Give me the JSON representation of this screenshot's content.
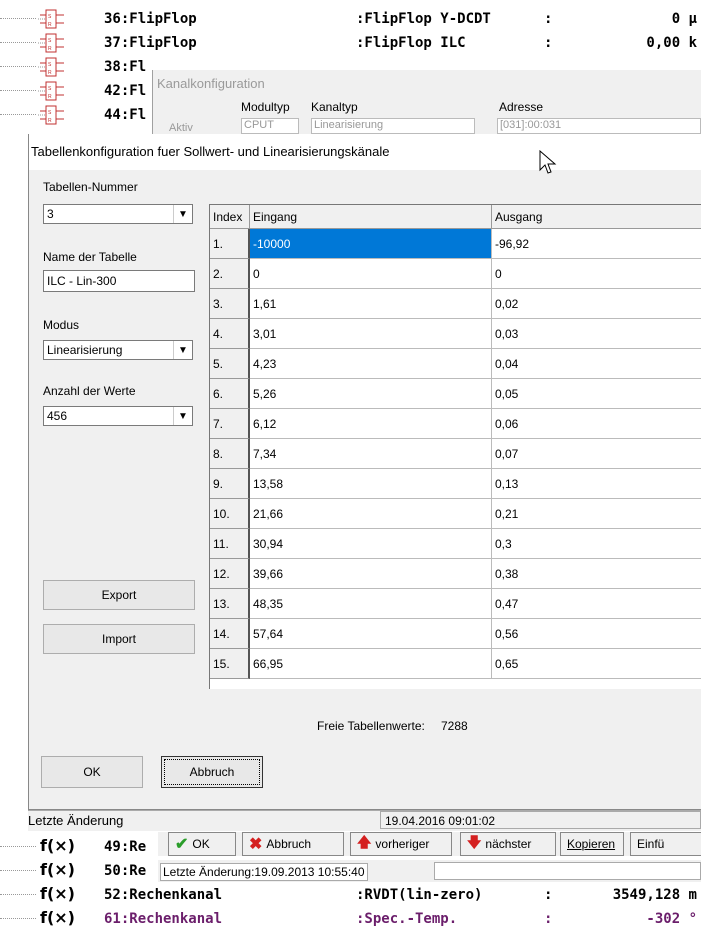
{
  "tree_rows": [
    {
      "id": "36",
      "name": "36:FlipFlop",
      "type": ":FlipFlop Y-DCDT",
      "colon": ":",
      "value": "0 µ",
      "icon": "flipflop"
    },
    {
      "id": "37",
      "name": "37:FlipFlop",
      "type": ":FlipFlop ILC",
      "colon": ":",
      "value": "0,00 k",
      "icon": "flipflop"
    },
    {
      "id": "38",
      "name": "38:Fl",
      "icon": "flipflop"
    },
    {
      "id": "42",
      "name": "42:Fl",
      "icon": "flipflop"
    },
    {
      "id": "44",
      "name": "44:Fl",
      "icon": "flipflop"
    },
    {
      "id": "49",
      "name": "49:Re",
      "icon": "function"
    },
    {
      "id": "50",
      "name": "50:Re",
      "icon": "function"
    },
    {
      "id": "52",
      "name": "52:Rechenkanal",
      "type": ":RVDT(lin-zero)",
      "colon": ":",
      "value": "3549,128 m",
      "icon": "function"
    },
    {
      "id": "61",
      "name": "61:Rechenkanal",
      "type": ":Spec.-Temp.",
      "colon": ":",
      "value": "-302 °",
      "icon": "function"
    }
  ],
  "kanal": {
    "title": "Kanalkonfiguration",
    "modultyp_label": "Modultyp",
    "kanaltyp_label": "Kanaltyp",
    "adresse_label": "Adresse",
    "aktiv_label": "Aktiv",
    "modultyp_value": "CPUT",
    "kanaltyp_value": "Linearisierung",
    "adresse_value": "[031]:00:031"
  },
  "dialog": {
    "title": "Tabellenkonfiguration fuer Sollwert- und Linearisierungskänale",
    "tabellen_nummer_label": "Tabellen-Nummer",
    "tabellen_nummer": "3",
    "name_label": "Name der Tabelle",
    "name_value": "ILC - Lin-300",
    "modus_label": "Modus",
    "modus_value": "Linearisierung",
    "anzahl_label": "Anzahl der Werte",
    "anzahl_value": "456",
    "export_label": "Export",
    "import_label": "Import",
    "ok_label": "OK",
    "abbruch_label": "Abbruch",
    "freie_label": "Freie Tabellenwerte:",
    "freie_value": "7288"
  },
  "grid": {
    "headers": {
      "index": "Index",
      "eingang": "Eingang",
      "ausgang": "Ausgang"
    },
    "rows": [
      {
        "i": "1.",
        "e": "-10000",
        "a": "-96,92"
      },
      {
        "i": "2.",
        "e": "0",
        "a": "0"
      },
      {
        "i": "3.",
        "e": "1,61",
        "a": "0,02"
      },
      {
        "i": "4.",
        "e": "3,01",
        "a": "0,03"
      },
      {
        "i": "5.",
        "e": "4,23",
        "a": "0,04"
      },
      {
        "i": "6.",
        "e": "5,26",
        "a": "0,05"
      },
      {
        "i": "7.",
        "e": "6,12",
        "a": "0,06"
      },
      {
        "i": "8.",
        "e": "7,34",
        "a": "0,07"
      },
      {
        "i": "9.",
        "e": "13,58",
        "a": "0,13"
      },
      {
        "i": "10.",
        "e": "21,66",
        "a": "0,21"
      },
      {
        "i": "11.",
        "e": "30,94",
        "a": "0,3"
      },
      {
        "i": "12.",
        "e": "39,66",
        "a": "0,38"
      },
      {
        "i": "13.",
        "e": "48,35",
        "a": "0,47"
      },
      {
        "i": "14.",
        "e": "57,64",
        "a": "0,56"
      },
      {
        "i": "15.",
        "e": "66,95",
        "a": "0,65"
      }
    ],
    "selected_row": 0,
    "selection_color": "#0078d7"
  },
  "status": {
    "letzte_label": "Letzte Änderung",
    "letzte_value": "19.04.2016 09:01:02"
  },
  "toolbar": {
    "ok": "OK",
    "abbruch": "Abbruch",
    "vorheriger": "vorheriger",
    "naechster": "nächster",
    "kopieren": "Kopieren",
    "einfuegen": "Einfü"
  },
  "bottom_status": {
    "letzte": "Letzte Änderung:19.09.2013 10:55:40"
  }
}
